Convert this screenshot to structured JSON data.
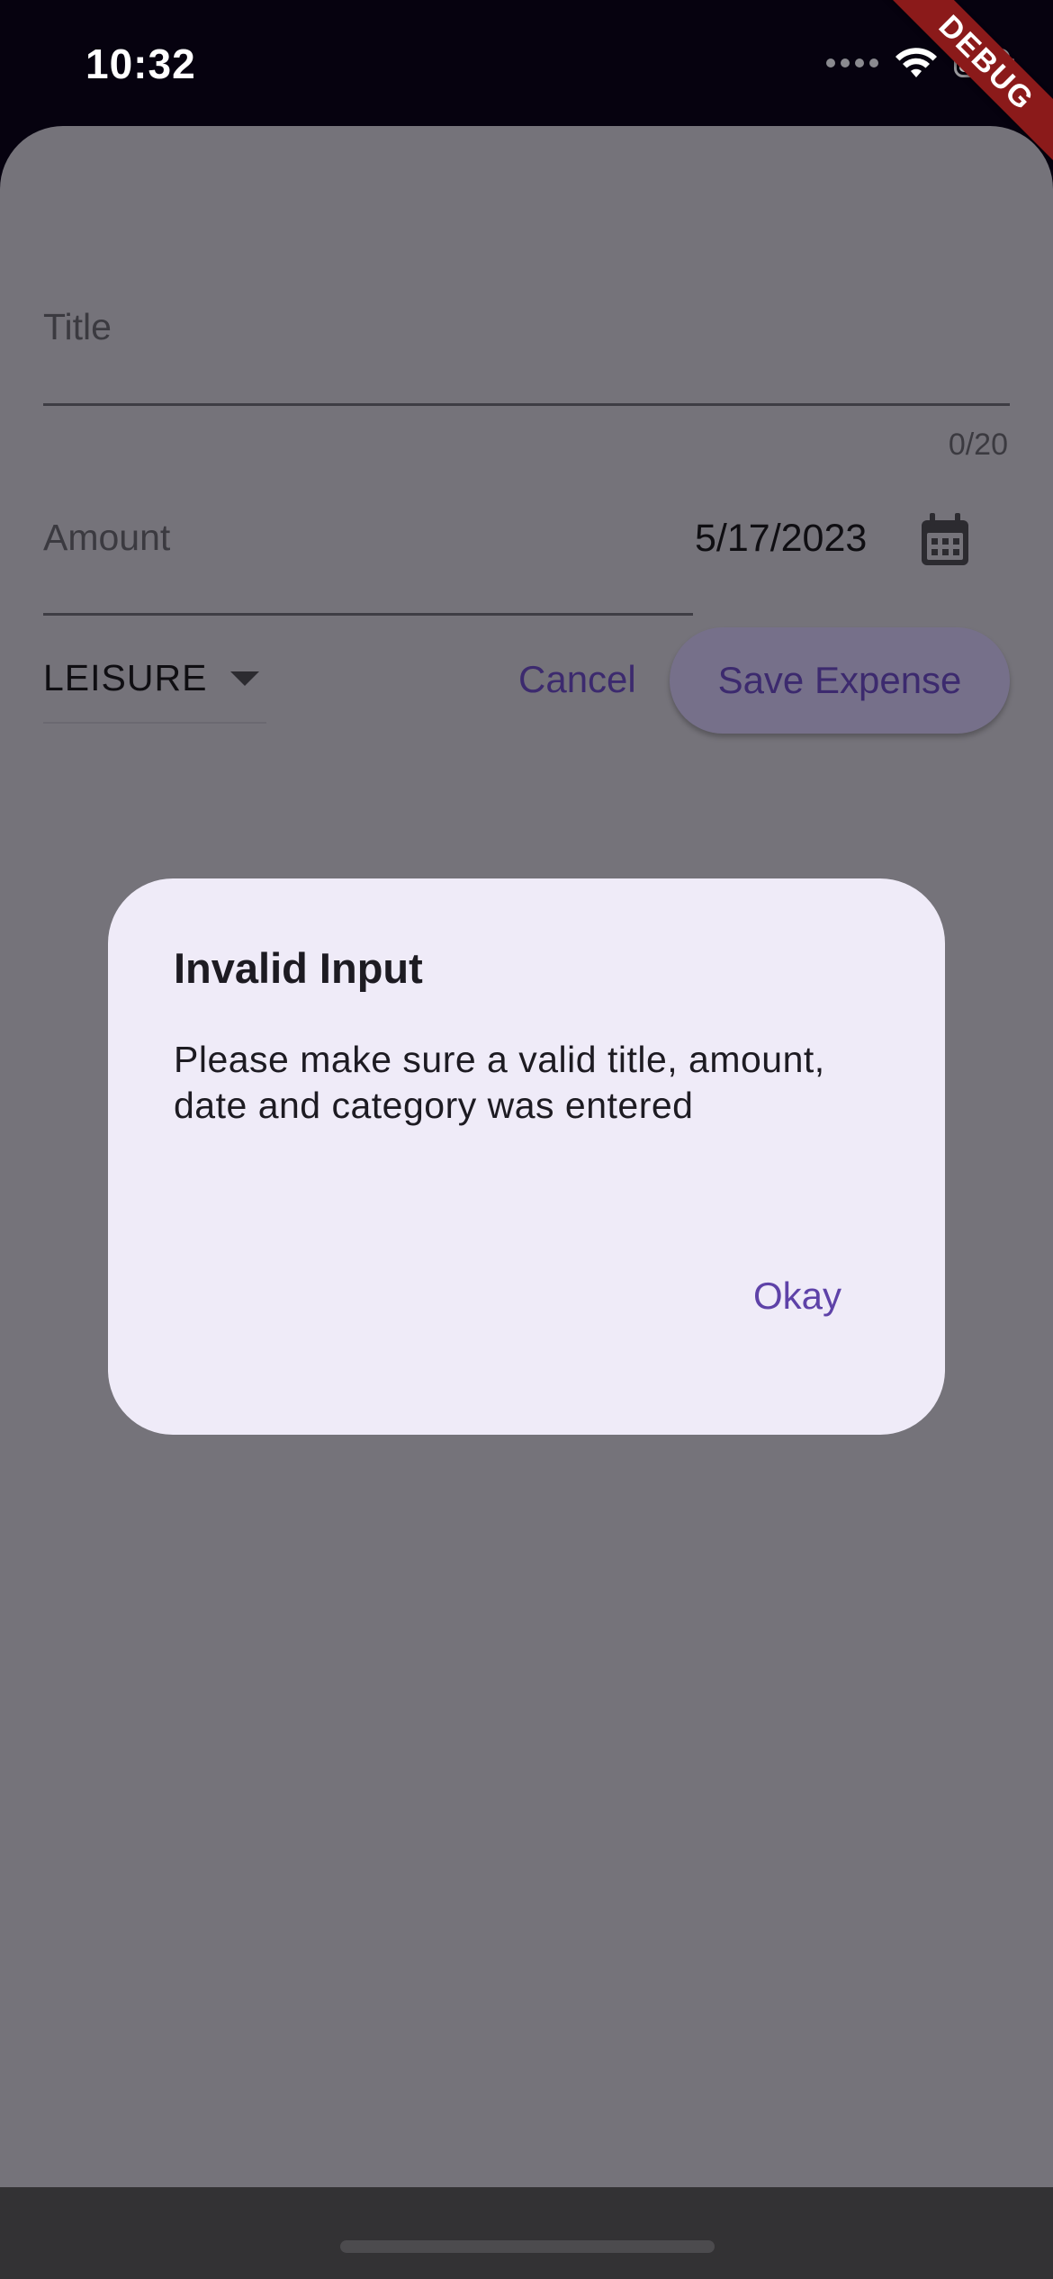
{
  "status_bar": {
    "time": "10:32",
    "debug_banner": "DEBUG"
  },
  "form": {
    "title_label": "Title",
    "title_counter": "0/20",
    "amount_label": "Amount",
    "date_value": "5/17/2023",
    "category_value": "LEISURE",
    "cancel_label": "Cancel",
    "save_label": "Save Expense"
  },
  "dialog": {
    "title": "Invalid Input",
    "message": "Please make sure a valid title, amount, date and category was entered",
    "okay_label": "Okay"
  },
  "colors": {
    "accent": "#5e42a8",
    "scrim_sheet": "#75737a",
    "dialog_bg": "#efebf8",
    "debug_ribbon": "#8b1a1a"
  },
  "icons": [
    "wifi-icon",
    "battery-icon",
    "calendar-icon",
    "dropdown-caret-icon"
  ]
}
